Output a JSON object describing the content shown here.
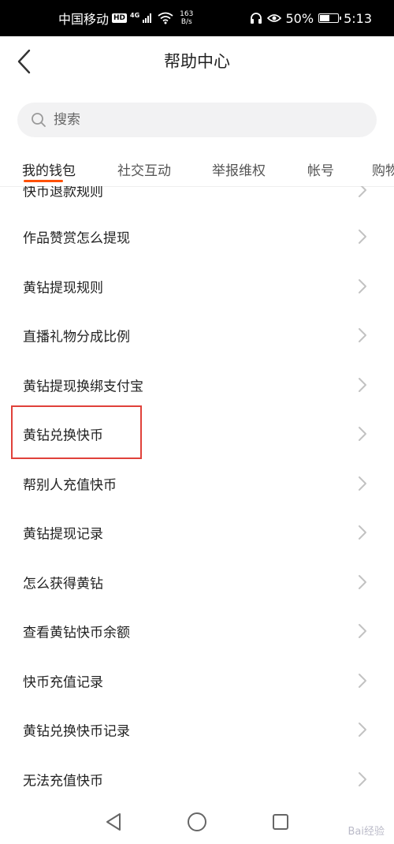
{
  "status_bar": {
    "carrier": "中国移动",
    "hd_badge": "HD",
    "network": "4G",
    "speed_value": "163",
    "speed_unit": "B/s",
    "battery": "50%",
    "time": "5:13"
  },
  "header": {
    "title": "帮助中心",
    "back_icon": "chevron-left-icon"
  },
  "search": {
    "placeholder": "搜索",
    "value": ""
  },
  "tabs": [
    {
      "label": "我的钱包",
      "active": true
    },
    {
      "label": "社交互动",
      "active": false
    },
    {
      "label": "举报维权",
      "active": false
    },
    {
      "label": "帐号",
      "active": false
    },
    {
      "label": "购物",
      "active": false
    }
  ],
  "list": {
    "items": [
      {
        "label": "快币退款规则"
      },
      {
        "label": "作品赞赏怎么提现"
      },
      {
        "label": "黄钻提现规则"
      },
      {
        "label": "直播礼物分成比例"
      },
      {
        "label": "黄钻提现换绑支付宝"
      },
      {
        "label": "黄钻兑换快币",
        "highlighted": true
      },
      {
        "label": "帮别人充值快币"
      },
      {
        "label": "黄钻提现记录"
      },
      {
        "label": "怎么获得黄钻"
      },
      {
        "label": "查看黄钻快币余额"
      },
      {
        "label": "快币充值记录"
      },
      {
        "label": "黄钻兑换快币记录"
      },
      {
        "label": "无法充值快币"
      }
    ]
  },
  "watermark": "Bai经验",
  "colors": {
    "accent": "#ff5000",
    "highlight_border": "#e0413a",
    "search_bg": "#f2f2f3"
  }
}
